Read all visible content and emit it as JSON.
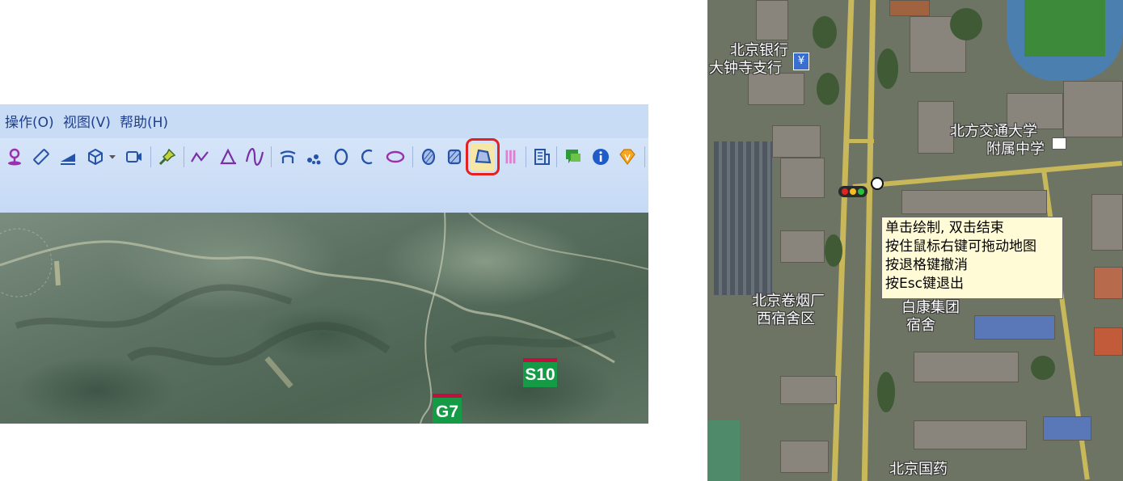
{
  "menu": {
    "items": [
      {
        "label": "操作(O)"
      },
      {
        "label": "视图(V)"
      },
      {
        "label": "帮助(H)"
      }
    ]
  },
  "toolbar": {
    "tools": [
      {
        "icon": "placemark-icon"
      },
      {
        "icon": "ruler-icon"
      },
      {
        "icon": "measure-area-icon"
      },
      {
        "icon": "cube-icon"
      },
      {
        "icon": "dropdown-arrow-icon"
      },
      {
        "icon": "video-camera-icon"
      },
      {
        "icon": "pushpin-icon"
      },
      {
        "icon": "polyline-icon"
      },
      {
        "icon": "triangle-icon"
      },
      {
        "icon": "curve-icon"
      },
      {
        "icon": "arc-lines-icon"
      },
      {
        "icon": "points-icon"
      },
      {
        "icon": "circle-icon"
      },
      {
        "icon": "open-arc-icon"
      },
      {
        "icon": "ellipse-icon"
      },
      {
        "icon": "hatched-circle-icon"
      },
      {
        "icon": "hatched-rectangle-icon"
      },
      {
        "icon": "polygon-icon",
        "selected": true
      },
      {
        "icon": "vertical-bars-icon"
      },
      {
        "icon": "building-icon"
      },
      {
        "icon": "comment-icon"
      },
      {
        "icon": "info-icon"
      },
      {
        "icon": "diamond-icon"
      }
    ]
  },
  "left_map": {
    "markers": [
      {
        "label": "S10"
      },
      {
        "label": "G7"
      }
    ]
  },
  "right_map": {
    "labels": [
      {
        "line1": "北京银行",
        "line2": "大钟寺支行"
      },
      {
        "line1": "北方交通大学",
        "line2": "附属中学"
      },
      {
        "line1": "北京卷烟厂",
        "line2": "西宿舍区"
      },
      {
        "line1": "白康集团",
        "line2": "宿舍"
      },
      {
        "line1": "北京国药",
        "line2": ""
      }
    ]
  },
  "tooltip": {
    "lines": [
      "单击绘制, 双击结束",
      "按住鼠标右键可拖动地图",
      "按退格键撤消",
      "按Esc键退出"
    ]
  },
  "colors": {
    "menu_text": "#1f3f8a",
    "toolbar_bg": "#c9dcf6",
    "selection_outline": "#e52020",
    "highway_shield": "#159a45",
    "tooltip_bg": "#fffbd6"
  }
}
